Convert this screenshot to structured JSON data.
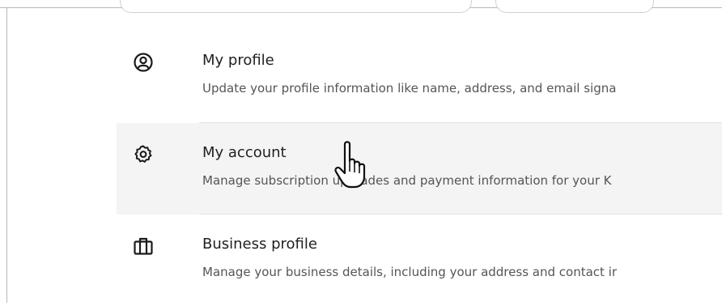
{
  "menu": {
    "items": [
      {
        "icon": "user-circle-icon",
        "title": "My profile",
        "description": "Update your profile information like name, address, and email signa"
      },
      {
        "icon": "gear-icon",
        "title": "My account",
        "description": "Manage subscription upgrades and payment information for your K"
      },
      {
        "icon": "briefcase-icon",
        "title": "Business profile",
        "description": "Manage your business details, including your address and contact ir"
      }
    ],
    "hovered_index": 1
  },
  "cursor": {
    "icon": "hand-pointer-icon"
  },
  "colors": {
    "hover_background": "#f4f4f4",
    "divider": "#e3e3e3",
    "title_text": "#1f1f1f",
    "description_text": "#555555"
  }
}
